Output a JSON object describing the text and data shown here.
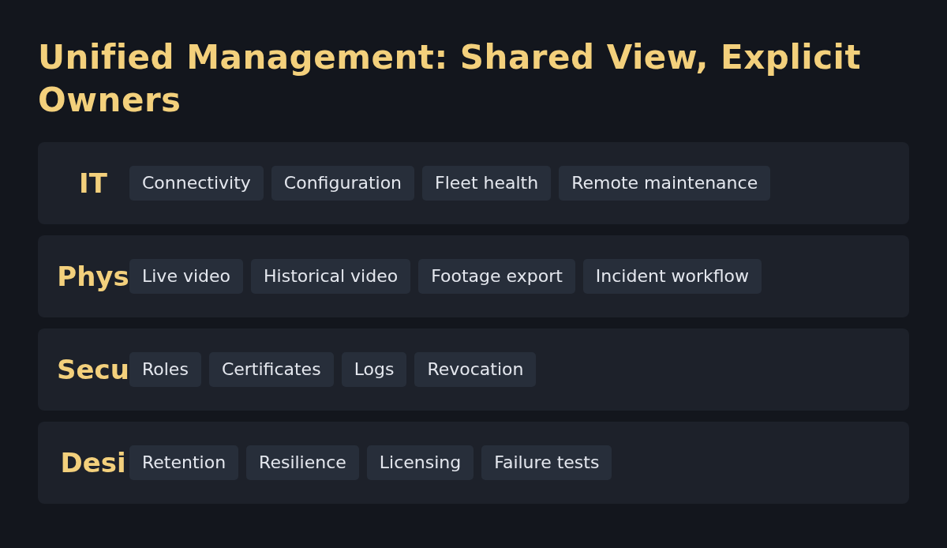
{
  "title": "Unified Management: Shared View, Explicit Owners",
  "rows": [
    {
      "label": "IT",
      "items": [
        "Connectivity",
        "Configuration",
        "Fleet health",
        "Remote maintenance"
      ]
    },
    {
      "label": "Phys",
      "items": [
        "Live video",
        "Historical video",
        "Footage export",
        "Incident workflow"
      ]
    },
    {
      "label": "Secu",
      "items": [
        "Roles",
        "Certificates",
        "Logs",
        "Revocation"
      ]
    },
    {
      "label": "Desi",
      "items": [
        "Retention",
        "Resilience",
        "Licensing",
        "Failure tests"
      ]
    }
  ]
}
